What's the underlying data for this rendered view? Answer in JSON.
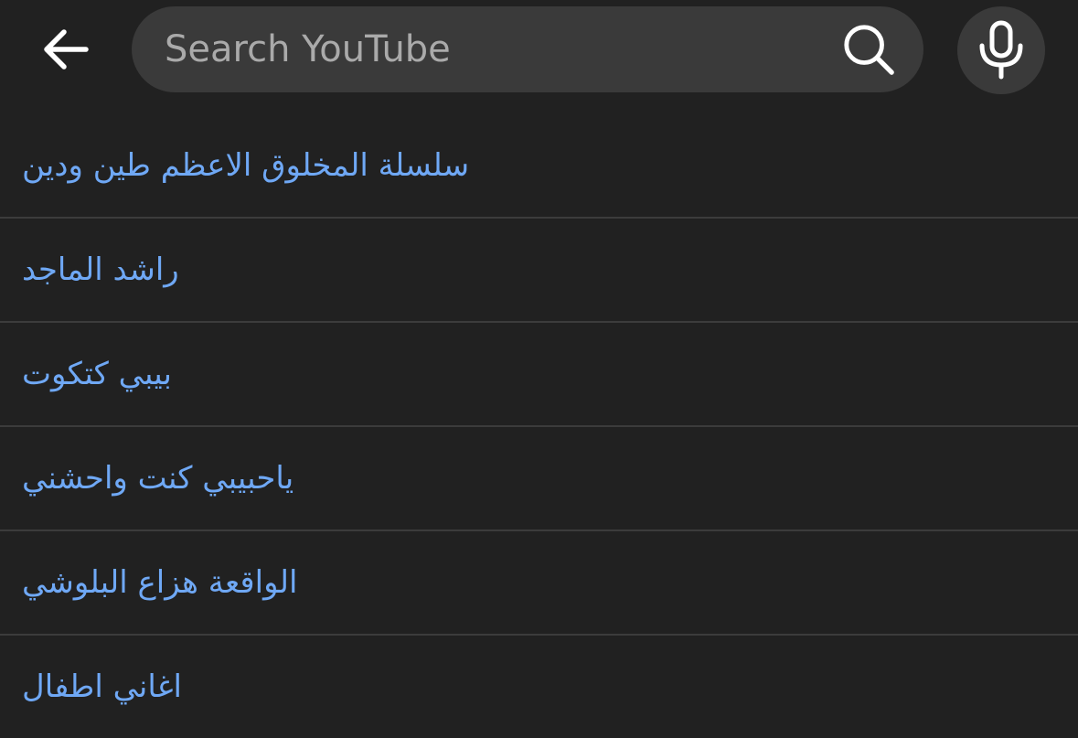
{
  "header": {
    "back_icon": "arrow-left-icon",
    "search_placeholder": "Search YouTube",
    "search_value": "",
    "search_icon": "search-icon",
    "mic_icon": "microphone-icon"
  },
  "suggestions": [
    "سلسلة المخلوق الاعظم طين ودين",
    "راشد الماجد",
    "بيبي كتكوت",
    "ياحبيبي كنت واحشني",
    "الواقعة هزاع البلوشي",
    "اغاني اطفال"
  ],
  "colors": {
    "background": "#212121",
    "search_box": "#3a3a3a",
    "suggestion_text": "#6fa8f5",
    "divider": "#3c3c3c",
    "icon": "#ffffff"
  }
}
